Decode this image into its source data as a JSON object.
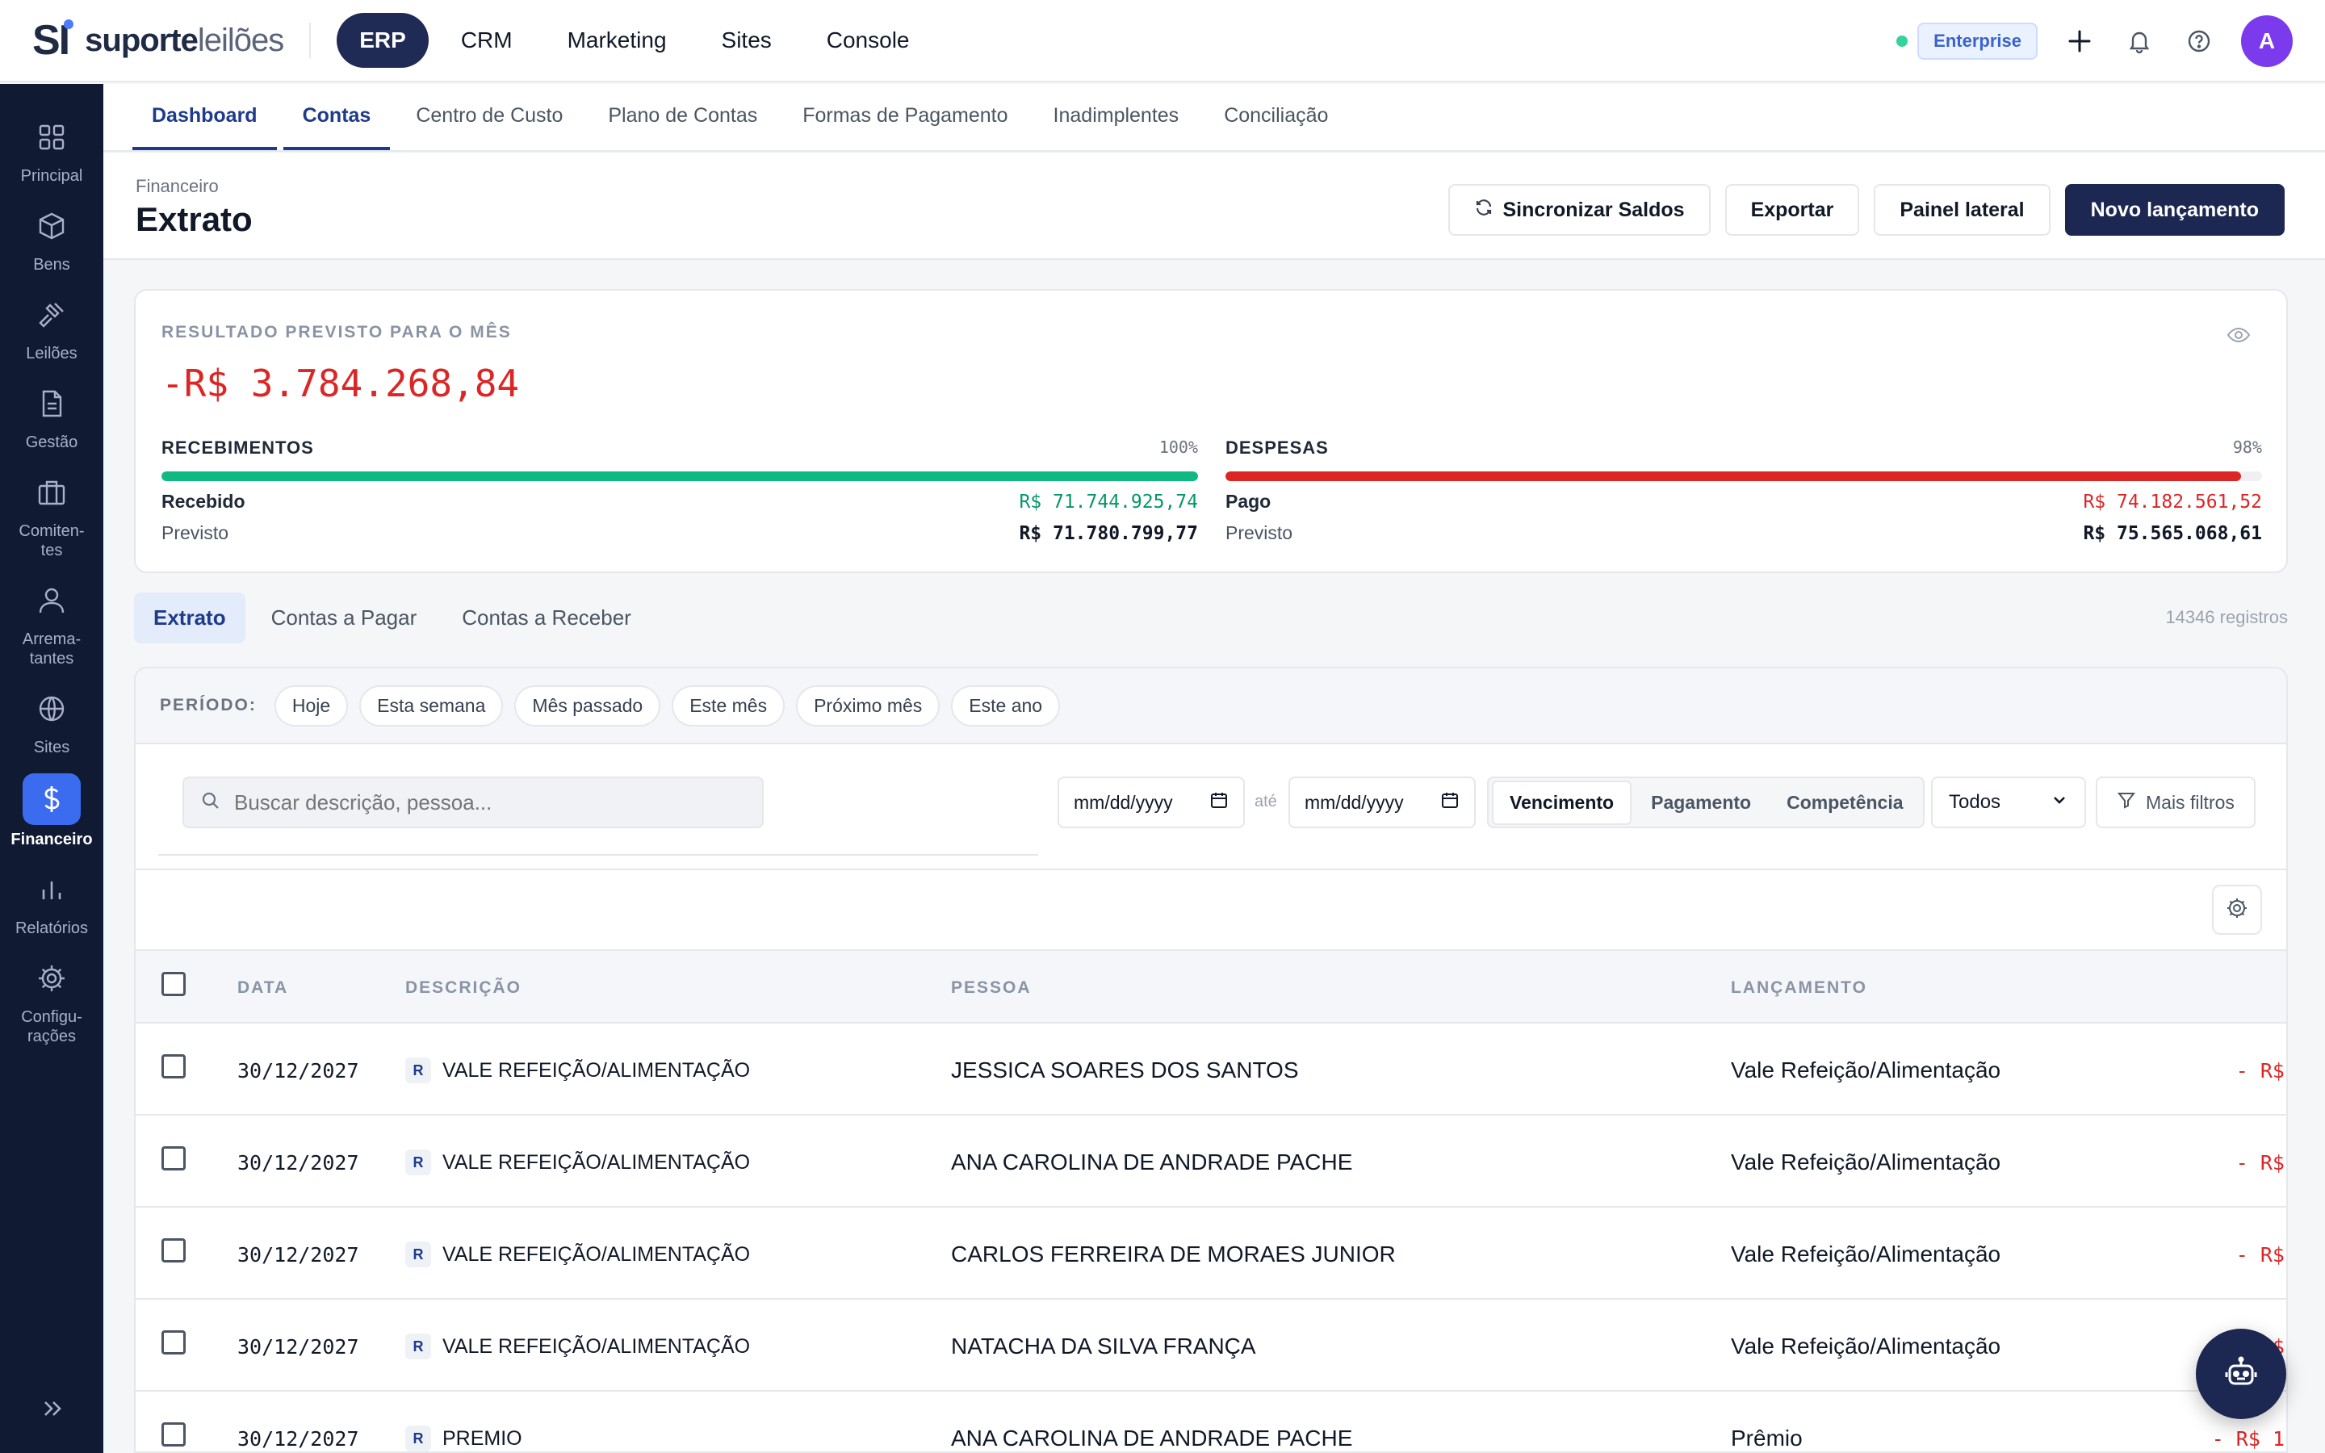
{
  "brand": {
    "mark": "SI",
    "name_a": "suporte",
    "name_b": "leilões"
  },
  "topnav": [
    {
      "label": "ERP",
      "active": true
    },
    {
      "label": "CRM",
      "active": false
    },
    {
      "label": "Marketing",
      "active": false
    },
    {
      "label": "Sites",
      "active": false
    },
    {
      "label": "Console",
      "active": false
    }
  ],
  "topbar": {
    "plan_badge": "Enterprise",
    "avatar_initial": "A",
    "status_color": "#34d399"
  },
  "sidebar": [
    {
      "label": "Principal",
      "icon": "grid-icon",
      "active": false
    },
    {
      "label": "Bens",
      "icon": "box-icon",
      "active": false
    },
    {
      "label": "Leilões",
      "icon": "gavel-icon",
      "active": false
    },
    {
      "label": "Gestão",
      "icon": "document-icon",
      "active": false
    },
    {
      "label": "Comiten-\ntes",
      "icon": "briefcase-icon",
      "active": false
    },
    {
      "label": "Arrema-\ntantes",
      "icon": "user-icon",
      "active": false
    },
    {
      "label": "Sites",
      "icon": "globe-icon",
      "active": false
    },
    {
      "label": "Financeiro",
      "icon": "dollar-icon",
      "active": true
    },
    {
      "label": "Relatórios",
      "icon": "bar-chart-icon",
      "active": false
    },
    {
      "label": "Configu-\nrações",
      "icon": "gear-icon",
      "active": false
    }
  ],
  "subnav": [
    {
      "label": "Dashboard",
      "active": true
    },
    {
      "label": "Contas",
      "active": true
    },
    {
      "label": "Centro de Custo",
      "active": false
    },
    {
      "label": "Plano de Contas",
      "active": false
    },
    {
      "label": "Formas de Pagamento",
      "active": false
    },
    {
      "label": "Inadimplentes",
      "active": false
    },
    {
      "label": "Conciliação",
      "active": false
    }
  ],
  "header": {
    "breadcrumb": "Financeiro",
    "title": "Extrato",
    "actions": {
      "sync": "Sincronizar Saldos",
      "export": "Exportar",
      "side_panel": "Painel lateral",
      "new_entry": "Novo lançamento"
    }
  },
  "summary": {
    "label": "RESULTADO PREVISTO PARA O MÊS",
    "value": "-R$ 3.784.268,84",
    "receipts": {
      "title": "RECEBIMENTOS",
      "percent_label": "100%",
      "percent": 100,
      "color": "#10b981",
      "received_label": "Recebido",
      "received_value": "R$ 71.744.925,74",
      "forecast_label": "Previsto",
      "forecast_value": "R$ 71.780.799,77"
    },
    "expenses": {
      "title": "DESPESAS",
      "percent_label": "98%",
      "percent": 98,
      "color": "#dc2626",
      "paid_label": "Pago",
      "paid_value": "R$ 74.182.561,52",
      "forecast_label": "Previsto",
      "forecast_value": "R$ 75.565.068,61"
    }
  },
  "list_tabs": [
    {
      "label": "Extrato",
      "active": true
    },
    {
      "label": "Contas a Pagar",
      "active": false
    },
    {
      "label": "Contas a Receber",
      "active": false
    }
  ],
  "records_count": "14346 registros",
  "period": {
    "label": "PERÍODO:",
    "chips": [
      "Hoje",
      "Esta semana",
      "Mês passado",
      "Este mês",
      "Próximo mês",
      "Este ano"
    ]
  },
  "filters": {
    "search_placeholder": "Buscar descrição, pessoa...",
    "date_from": "mm/dd/yyyy",
    "date_sep": "até",
    "date_to": "mm/dd/yyyy",
    "date_type": [
      {
        "label": "Vencimento",
        "active": true
      },
      {
        "label": "Pagamento",
        "active": false
      },
      {
        "label": "Competência",
        "active": false
      }
    ],
    "status_select": "Todos",
    "more_filters": "Mais filtros"
  },
  "table": {
    "headers": {
      "date": "DATA",
      "description": "DESCRIÇÃO",
      "person": "PESSOA",
      "entry": "LANÇAMENTO"
    },
    "rows": [
      {
        "date": "30/12/2027",
        "badge": "R",
        "description": "VALE REFEIÇÃO/ALIMENTAÇÃO",
        "person": "JESSICA SOARES DOS SANTOS",
        "entry": "Vale Refeição/Alimentação",
        "amount": "- R$"
      },
      {
        "date": "30/12/2027",
        "badge": "R",
        "description": "VALE REFEIÇÃO/ALIMENTAÇÃO",
        "person": "ANA CAROLINA DE ANDRADE PACHE",
        "entry": "Vale Refeição/Alimentação",
        "amount": "- R$"
      },
      {
        "date": "30/12/2027",
        "badge": "R",
        "description": "VALE REFEIÇÃO/ALIMENTAÇÃO",
        "person": "CARLOS FERREIRA DE MORAES JUNIOR",
        "entry": "Vale Refeição/Alimentação",
        "amount": "- R$"
      },
      {
        "date": "30/12/2027",
        "badge": "R",
        "description": "VALE REFEIÇÃO/ALIMENTAÇÃO",
        "person": "NATACHA DA SILVA FRANÇA",
        "entry": "Vale Refeição/Alimentação",
        "amount": "- R$"
      },
      {
        "date": "30/12/2027",
        "badge": "R",
        "description": "PREMIO",
        "person": "ANA CAROLINA DE ANDRADE PACHE",
        "entry": "Prêmio",
        "amount": "- R$ 1"
      }
    ]
  }
}
